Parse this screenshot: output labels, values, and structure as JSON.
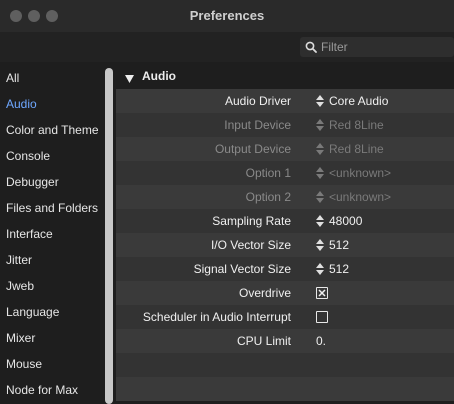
{
  "window": {
    "title": "Preferences"
  },
  "filter": {
    "placeholder": "Filter"
  },
  "sidebar": {
    "items": [
      {
        "label": "All"
      },
      {
        "label": "Audio"
      },
      {
        "label": "Color and Theme"
      },
      {
        "label": "Console"
      },
      {
        "label": "Debugger"
      },
      {
        "label": "Files and Folders"
      },
      {
        "label": "Interface"
      },
      {
        "label": "Jitter"
      },
      {
        "label": "Jweb"
      },
      {
        "label": "Language"
      },
      {
        "label": "Mixer"
      },
      {
        "label": "Mouse"
      },
      {
        "label": "Node for Max"
      }
    ],
    "selected": "Audio"
  },
  "section": {
    "title": "Audio",
    "expanded": true
  },
  "settings": [
    {
      "label": "Audio Driver",
      "value": "Core Audio",
      "control": "dropdown",
      "enabled": true
    },
    {
      "label": "Input Device",
      "value": "Red 8Line",
      "control": "dropdown",
      "enabled": false
    },
    {
      "label": "Output Device",
      "value": "Red 8Line",
      "control": "dropdown",
      "enabled": false
    },
    {
      "label": "Option 1",
      "value": "<unknown>",
      "control": "dropdown",
      "enabled": false
    },
    {
      "label": "Option 2",
      "value": "<unknown>",
      "control": "dropdown",
      "enabled": false
    },
    {
      "label": "Sampling Rate",
      "value": "48000",
      "control": "dropdown",
      "enabled": true
    },
    {
      "label": "I/O Vector Size",
      "value": "512",
      "control": "dropdown",
      "enabled": true
    },
    {
      "label": "Signal Vector Size",
      "value": "512",
      "control": "dropdown",
      "enabled": true
    },
    {
      "label": "Overdrive",
      "checked": true,
      "control": "checkbox",
      "enabled": true
    },
    {
      "label": "Scheduler in Audio Interrupt",
      "checked": false,
      "control": "checkbox",
      "enabled": true
    },
    {
      "label": "CPU Limit",
      "value": "0.",
      "control": "number",
      "enabled": true
    }
  ],
  "icons": {
    "search": "search-icon",
    "disclosure": "triangle-down-icon",
    "stepper": "up-down-arrows-icon"
  },
  "colors": {
    "accent": "#6fa8ff",
    "row_odd": "#3a3a3a",
    "row_even": "#333333"
  }
}
